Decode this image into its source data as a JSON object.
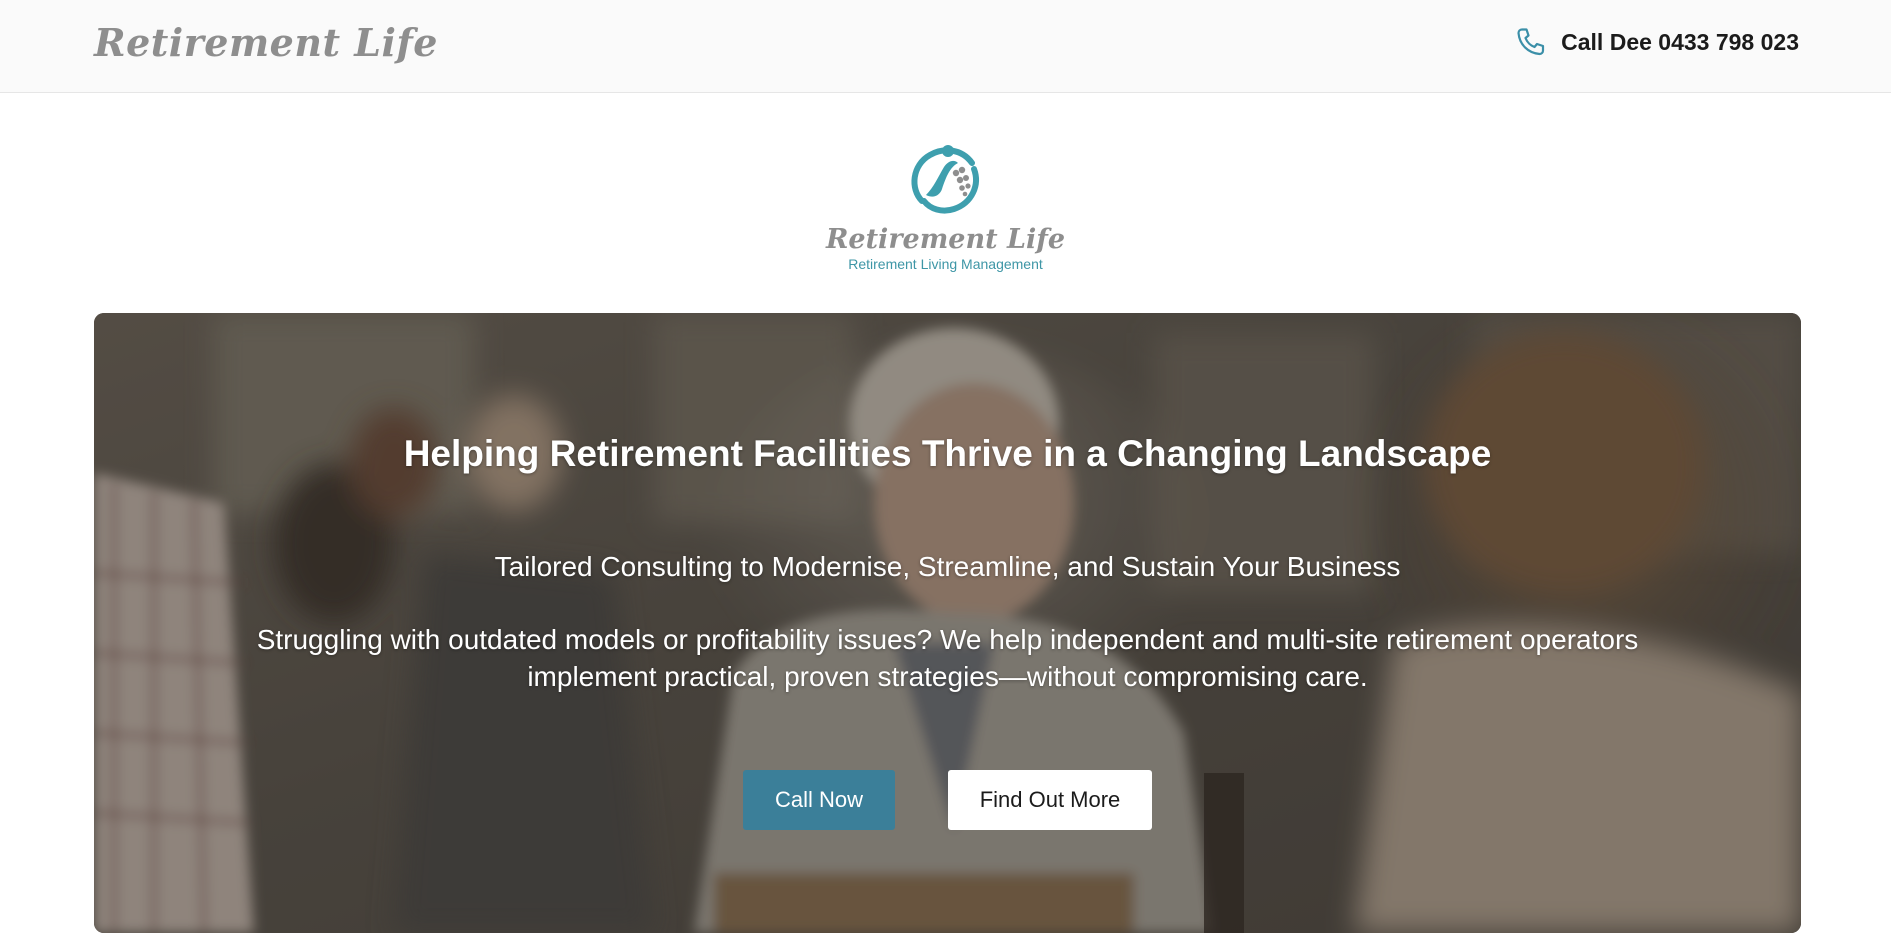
{
  "header": {
    "brand": "Retirement Life",
    "phone_label": "Call Dee 0433 798 023",
    "phone_icon": "phone-icon"
  },
  "logo": {
    "name": "Retirement Life",
    "tagline": "Retirement Living Management",
    "icon": "retirement-life-logo-mark"
  },
  "hero": {
    "title": "Helping Retirement Facilities Thrive in a Changing Landscape",
    "subtitle": "Tailored Consulting to Modernise, Streamline, and Sustain Your Business",
    "body": "Struggling with outdated models or profitability issues? We help independent and multi-site retirement operators implement practical, proven strategies—without compromising care.",
    "primary_cta": "Call Now",
    "secondary_cta": "Find Out More"
  },
  "colors": {
    "accent": "#3b7f99",
    "logo_teal": "#3e96a6",
    "brand_grey": "#8e8e8e",
    "header_bg": "#fafafa"
  }
}
